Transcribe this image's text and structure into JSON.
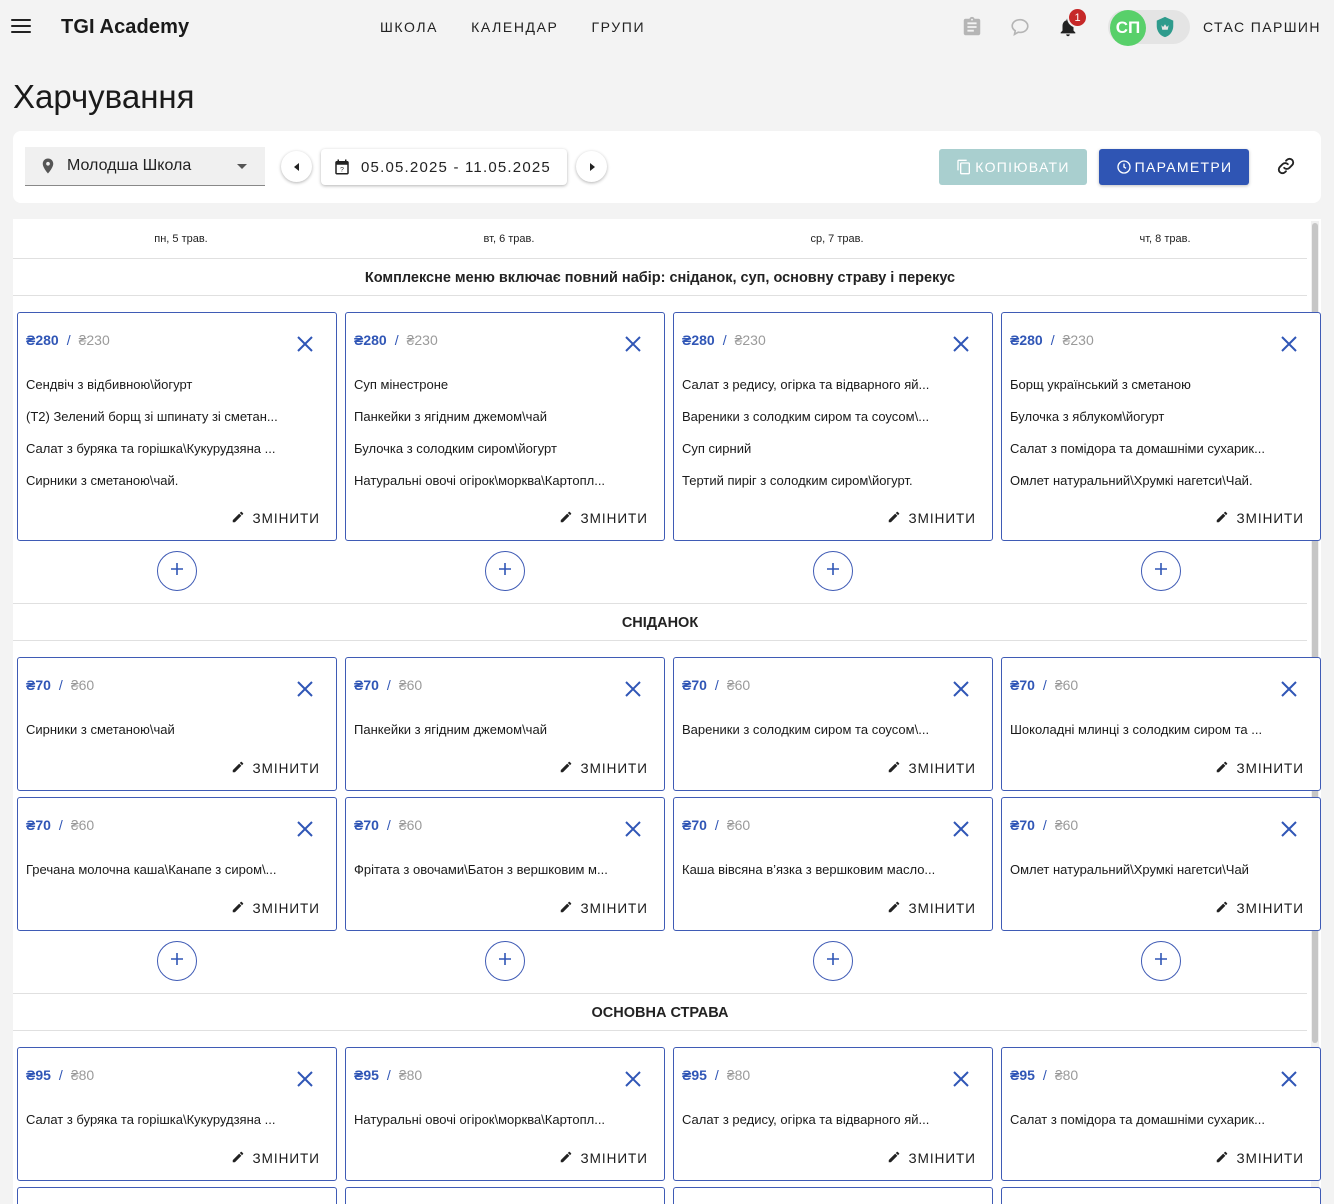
{
  "app": {
    "brand": "TGI Academy"
  },
  "nav": {
    "items": [
      "ШКОЛА",
      "КАЛЕНДАР",
      "ГРУПИ"
    ]
  },
  "header": {
    "notification_count": "1",
    "avatar_initials": "СП",
    "user_name": "СТАС ПАРШИН"
  },
  "page": {
    "title": "Харчування"
  },
  "toolbar": {
    "school": "Молодша Школа",
    "date_range": "05.05.2025 - 11.05.2025",
    "copy_label": "КОПІЮВАТИ",
    "params_label": "ПАРАМЕТРИ"
  },
  "days": [
    "пн, 5 трав.",
    "вт, 6 трав.",
    "ср, 7 трав.",
    "чт, 8 трав."
  ],
  "edit_label": "ЗМІНИТИ",
  "sections": [
    {
      "title": "Комплексне меню включає повний набір: сніданок, суп, основну страву і перекус",
      "price": "₴280",
      "price2": "₴230",
      "rows": [
        [
          [
            "Сендвіч з відбивною\\йогурт",
            "(Т2) Зелений борщ зі шпинату зі сметан...",
            "Салат з буряка та горішка\\Кукурудзяна ...",
            "Сирники з сметаною\\чай."
          ],
          [
            "Суп мінестроне",
            "Панкейки з ягідним джемом\\чай",
            "Булочка з солодким сиром\\йогурт",
            "Натуральні овочі огірок\\морква\\Картопл..."
          ],
          [
            "Салат з редису, огірка та відварного яй...",
            "Вареники з солодким сиром та соусом\\...",
            "Суп сирний",
            "Тертий пиріг з солодким сиром\\йогурт."
          ],
          [
            "Борщ український з сметаною",
            "Булочка з яблуком\\йогурт",
            "Салат з помідора та домашніми сухарик...",
            "Омлет натуральний\\Хрумкі нагетси\\Чай."
          ]
        ]
      ]
    },
    {
      "title": "СНІДАНОК",
      "price": "₴70",
      "price2": "₴60",
      "rows": [
        [
          [
            "Сирники з сметаною\\чай"
          ],
          [
            "Панкейки з ягідним джемом\\чай"
          ],
          [
            "Вареники з солодким сиром та соусом\\..."
          ],
          [
            "Шоколадні млинці з солодким сиром та ..."
          ]
        ],
        [
          [
            "Гречана молочна каша\\Канапе з сиром\\..."
          ],
          [
            "Фрітата з овочами\\Батон з вершковим м..."
          ],
          [
            "Каша вівсяна в’язка з вершковим масло..."
          ],
          [
            "Омлет натуральний\\Хрумкі нагетси\\Чай"
          ]
        ]
      ]
    },
    {
      "title": "ОСНОВНА СТРАВА",
      "price": "₴95",
      "price2": "₴80",
      "rows": [
        [
          [
            "Салат з буряка та горішка\\Кукурудзяна ..."
          ],
          [
            "Натуральні овочі огірок\\морква\\Картопл..."
          ],
          [
            "Салат з редису, огірка та відварного яй..."
          ],
          [
            "Салат з помідора та домашніми сухарик..."
          ]
        ]
      ]
    }
  ],
  "colors": {
    "accent": "#3056b6",
    "copy_button": "#a9cfcf",
    "badge": "#c62828",
    "avatar": "#58d06a"
  }
}
